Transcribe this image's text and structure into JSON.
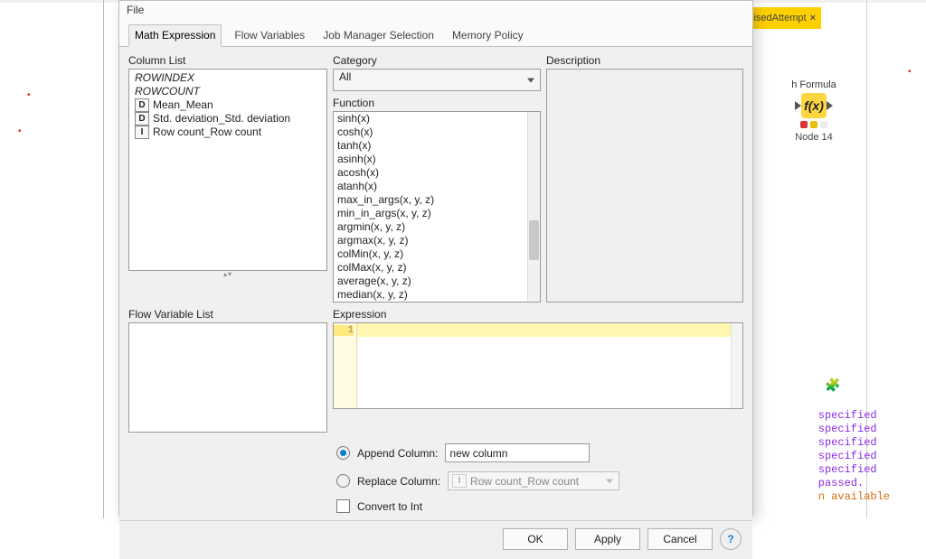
{
  "background": {
    "partial_tab_text": "isedAttempt",
    "node_title_top": "h Formula",
    "node_label": "Node 14",
    "log": {
      "l1": "specified",
      "l2": "specified",
      "l3": "specified",
      "l4": "specified",
      "l5": "specified",
      "l6": " passed.",
      "l7": "n available"
    }
  },
  "dialog": {
    "file_menu": "File",
    "tabs": {
      "math": "Math Expression",
      "flow": "Flow Variables",
      "job": "Job Manager Selection",
      "mem": "Memory Policy"
    },
    "column_list": {
      "label": "Column List",
      "items": {
        "rowindex": "ROWINDEX",
        "rowcount": "ROWCOUNT",
        "mean": "Mean_Mean",
        "std": "Std. deviation_Std. deviation",
        "rowcountcol": "Row count_Row count",
        "type_d": "D",
        "type_i": "I"
      }
    },
    "flowvar_label": "Flow Variable List",
    "category": {
      "label": "Category",
      "value": "All"
    },
    "description_label": "Description",
    "function_label": "Function",
    "functions": {
      "f0": "sinh(x)",
      "f1": "cosh(x)",
      "f2": "tanh(x)",
      "f3": "asinh(x)",
      "f4": "acosh(x)",
      "f5": "atanh(x)",
      "f6": "max_in_args(x, y, z)",
      "f7": "min_in_args(x, y, z)",
      "f8": "argmin(x, y, z)",
      "f9": "argmax(x, y, z)",
      "f10": "colMin(x, y, z)",
      "f11": "colMax(x, y, z)",
      "f12": "average(x, y, z)",
      "f13": "median(x, y, z)"
    },
    "expression_label": "Expression",
    "gutter_line": "1",
    "options": {
      "append_label": "Append Column:",
      "append_value": "new column",
      "replace_label": "Replace Column:",
      "replace_value": "Row count_Row count",
      "convert_label": "Convert to Int"
    },
    "buttons": {
      "ok": "OK",
      "apply": "Apply",
      "cancel": "Cancel",
      "help": "?"
    }
  }
}
